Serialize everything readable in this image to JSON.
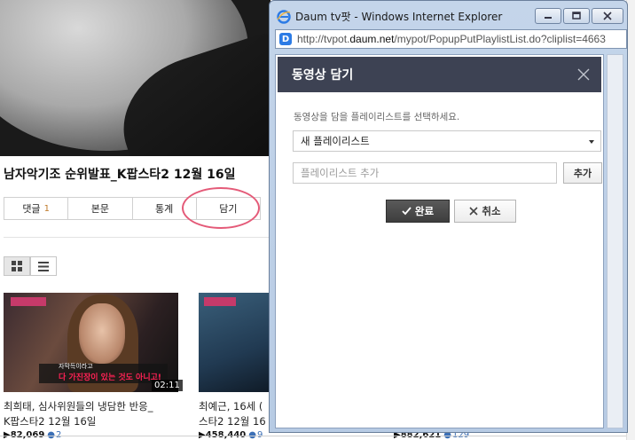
{
  "background": {
    "video_title": "남자악기조 순위발표_K팝스타2 12월 16일",
    "tabs": [
      {
        "label": "댓글",
        "count": "1"
      },
      {
        "label": "본문"
      },
      {
        "label": "통계"
      },
      {
        "label": "담기"
      }
    ],
    "view_toggle": {
      "active": "grid-icon",
      "other": "list-icon"
    },
    "videos": [
      {
        "caption_top": "자막득이라고",
        "caption_bottom": "다 가진장이 있는 것도 아니고!",
        "duration": "02:11",
        "desc_line1": "최희태, 심사위원들의 냉담한 반응_",
        "desc_line2": "K팝스타2 12월 16일",
        "views": "82,069",
        "sub": "2"
      },
      {
        "desc_line1": "최예근, 16세 (",
        "desc_line2": "스타2 12월 16",
        "views": "458,440",
        "sub": "9"
      },
      {
        "views": "882,621",
        "sub": "129"
      }
    ]
  },
  "ie_window": {
    "title": "Daum tv팟 - Windows Internet Explorer",
    "url_prefix": "http://tvpot.",
    "url_domain": "daum.net",
    "url_path": "/mypot/PopupPutPlaylistList.do?cliplist=4663",
    "buttons": [
      "minimize",
      "maximize",
      "close"
    ]
  },
  "dialog": {
    "title": "동영상 담기",
    "hint": "동영상을 담을 플레이리스트를 선택하세요.",
    "select_value": "새 플레이리스트",
    "input_placeholder": "플레이리스트 추가",
    "add_label": "추가",
    "ok_label": "완료",
    "cancel_label": "취소"
  },
  "colors": {
    "dialog_header": "#3d4253",
    "highlight_circle": "#e45a78",
    "ie_frame": "#b7cbe4"
  }
}
